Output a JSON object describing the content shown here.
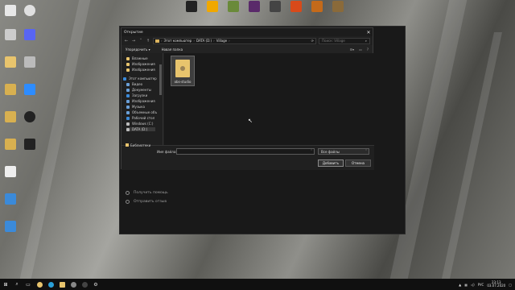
{
  "dialog": {
    "title": "Открытие",
    "close_glyph": "✕",
    "breadcrumb": [
      "Этот компьютер",
      "DATA (D:)",
      "Village"
    ],
    "search_placeholder": "Поиск: Village",
    "toolbar": {
      "organize": "Упорядочить ▾",
      "new_folder": "Новая папка"
    },
    "nav_items": [
      {
        "label": "Влажные",
        "color": "#e8c46d"
      },
      {
        "label": "Изображения",
        "color": "#e8c46d"
      },
      {
        "label": "Изображения",
        "color": "#e8c46d"
      },
      {
        "label": "Этот компьютер",
        "color": "#3b8ad9"
      },
      {
        "label": "Видео",
        "color": "#6aa0d8"
      },
      {
        "label": "Документы",
        "color": "#6aa0d8"
      },
      {
        "label": "Загрузки",
        "color": "#3b8ad9"
      },
      {
        "label": "Изображения",
        "color": "#6aa0d8"
      },
      {
        "label": "Музыка",
        "color": "#6aa0d8"
      },
      {
        "label": "Объемные объ",
        "color": "#6aa0d8"
      },
      {
        "label": "Рабочий стол",
        "color": "#3b8ad9"
      },
      {
        "label": "Windows (C:)",
        "color": "#bbbbbb"
      },
      {
        "label": "DATA (D:)",
        "color": "#bbbbbb"
      }
    ],
    "libraries_label": "Библиотеки",
    "file": {
      "name": "obs-studio"
    },
    "file_name_label": "Имя файла:",
    "file_name_value": "",
    "file_type": "Все файлы",
    "open_button": "Добавить",
    "cancel_button": "Отмена"
  },
  "backdrop": {
    "help": "Получить помощь",
    "feedback": "Отправить отзыв"
  },
  "top_icons": [
    "",
    "",
    "",
    "",
    "",
    "",
    "",
    ""
  ],
  "taskbar": {
    "time": "23:13",
    "date": "03.07.2020",
    "lang": "РУС"
  }
}
